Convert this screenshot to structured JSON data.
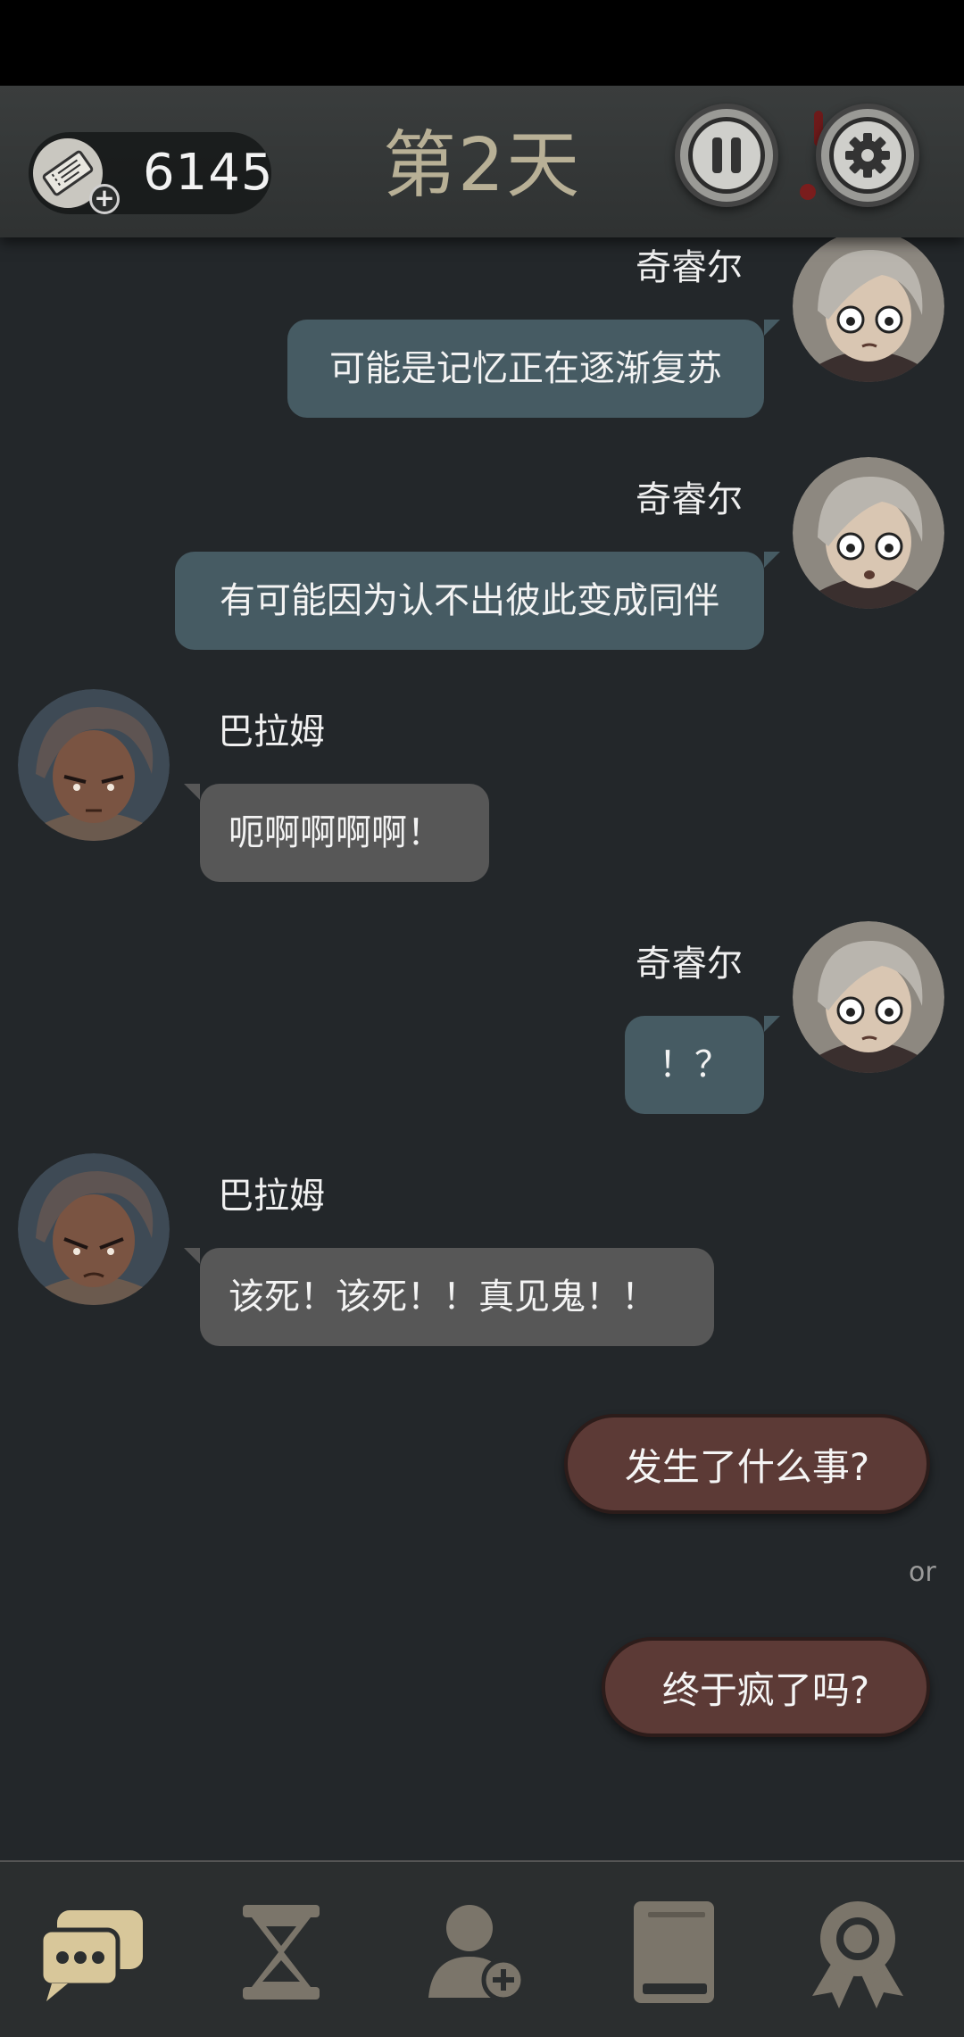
{
  "header": {
    "coin_count": "6145",
    "day_title": "第2天",
    "icons": {
      "ticket": "ticket-icon",
      "plus": "plus-icon",
      "pause": "pause-icon",
      "settings": "gear-icon"
    }
  },
  "messages": [
    {
      "side": "right",
      "sender": "奇睿尔",
      "text": "可能是记忆正在逐渐复苏"
    },
    {
      "side": "right",
      "sender": "奇睿尔",
      "text": "有可能因为认不出彼此变成同伴"
    },
    {
      "side": "left",
      "sender": "巴拉姆",
      "text": "呃啊啊啊啊！"
    },
    {
      "side": "right",
      "sender": "奇睿尔",
      "text": "！？"
    },
    {
      "side": "left",
      "sender": "巴拉姆",
      "text": "该死！该死！！真见鬼！！"
    }
  ],
  "choices": {
    "option_1": "发生了什么事?",
    "separator": "or",
    "option_2": "终于疯了吗?"
  },
  "bottom_nav": [
    {
      "name": "chat",
      "icon": "chat-bubbles-icon",
      "active": true
    },
    {
      "name": "time",
      "icon": "hourglass-icon",
      "active": false
    },
    {
      "name": "characters",
      "icon": "add-person-icon",
      "active": false
    },
    {
      "name": "book",
      "icon": "book-icon",
      "active": false
    },
    {
      "name": "achievements",
      "icon": "award-ribbon-icon",
      "active": false
    }
  ],
  "colors": {
    "accent_active": "#d8c79a",
    "nav_inactive": "#7b756a",
    "bubble_right": "#465b63",
    "bubble_left": "#575757",
    "choice": "#5c3a36"
  }
}
